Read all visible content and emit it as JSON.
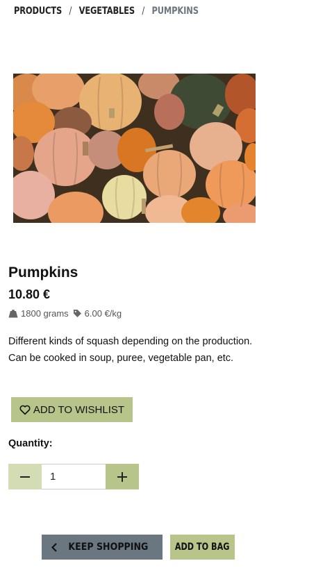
{
  "breadcrumb": {
    "items": [
      "PRODUCTS",
      "VEGETABLES"
    ],
    "separator": "/",
    "current": "PUMPKINS"
  },
  "product": {
    "image_alt": "pumpkins",
    "name": "Pumpkins",
    "price": "10.80 €",
    "weight": "1800 grams",
    "unit_price": "6.00 €/kg",
    "description": "Different kinds of squash depending on the production. Can be cooked in soup, puree, vegetable pan, etc."
  },
  "actions": {
    "wishlist_label": "ADD TO WISHLIST",
    "quantity_label": "Quantity:",
    "quantity_value": "1",
    "keep_shopping_label": "KEEP SHOPPING",
    "add_to_bag_label": "ADD TO BAG"
  },
  "colors": {
    "accent_green": "#b7c48a",
    "light_green": "#d3dcb4",
    "slate": "#6b7780"
  }
}
